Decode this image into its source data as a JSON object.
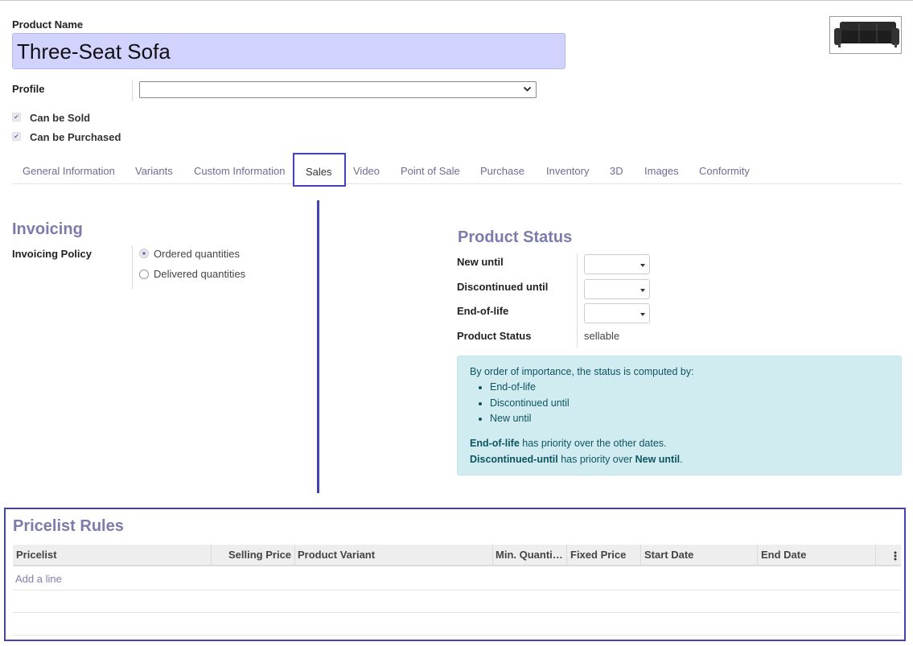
{
  "product": {
    "name_label": "Product Name",
    "name_value": "Three-Seat Sofa",
    "image_alt": "sofa-image"
  },
  "profile": {
    "label": "Profile",
    "selected": ""
  },
  "checkboxes": {
    "can_be_sold": "Can be Sold",
    "can_be_purchased": "Can be Purchased"
  },
  "tabs": [
    {
      "label": "General Information"
    },
    {
      "label": "Variants"
    },
    {
      "label": "Custom Information"
    },
    {
      "label": "Sales",
      "active": true
    },
    {
      "label": "Video"
    },
    {
      "label": "Point of Sale"
    },
    {
      "label": "Purchase"
    },
    {
      "label": "Inventory"
    },
    {
      "label": "3D"
    },
    {
      "label": "Images"
    },
    {
      "label": "Conformity"
    }
  ],
  "invoicing": {
    "title": "Invoicing",
    "policy_label": "Invoicing Policy",
    "options": [
      "Ordered quantities",
      "Delivered quantities"
    ],
    "selected": "Ordered quantities"
  },
  "product_status": {
    "title": "Product Status",
    "new_until_label": "New until",
    "discontinued_until_label": "Discontinued until",
    "end_of_life_label": "End-of-life",
    "status_label": "Product Status",
    "status_value": "sellable",
    "info_intro": "By order of importance, the status is computed by:",
    "info_items": [
      "End-of-life",
      "Discontinued until",
      "New until"
    ],
    "line1_bold": "End-of-life",
    "line1_rest": " has priority over the other dates.",
    "line2_bold1": "Discontinued-until",
    "line2_mid": " has priority over ",
    "line2_bold2": "New until",
    "line2_end": "."
  },
  "pricelist": {
    "title": "Pricelist Rules",
    "columns": [
      "Pricelist",
      "Selling Price",
      "Product Variant",
      "Min. Quanti…",
      "Fixed Price",
      "Start Date",
      "End Date"
    ],
    "add_line": "Add a line"
  },
  "colors": {
    "accent": "#4343b8",
    "section_title": "#7c7bad",
    "name_field_bg": "#d2d2ff",
    "info_bg": "#d1ecf1"
  }
}
